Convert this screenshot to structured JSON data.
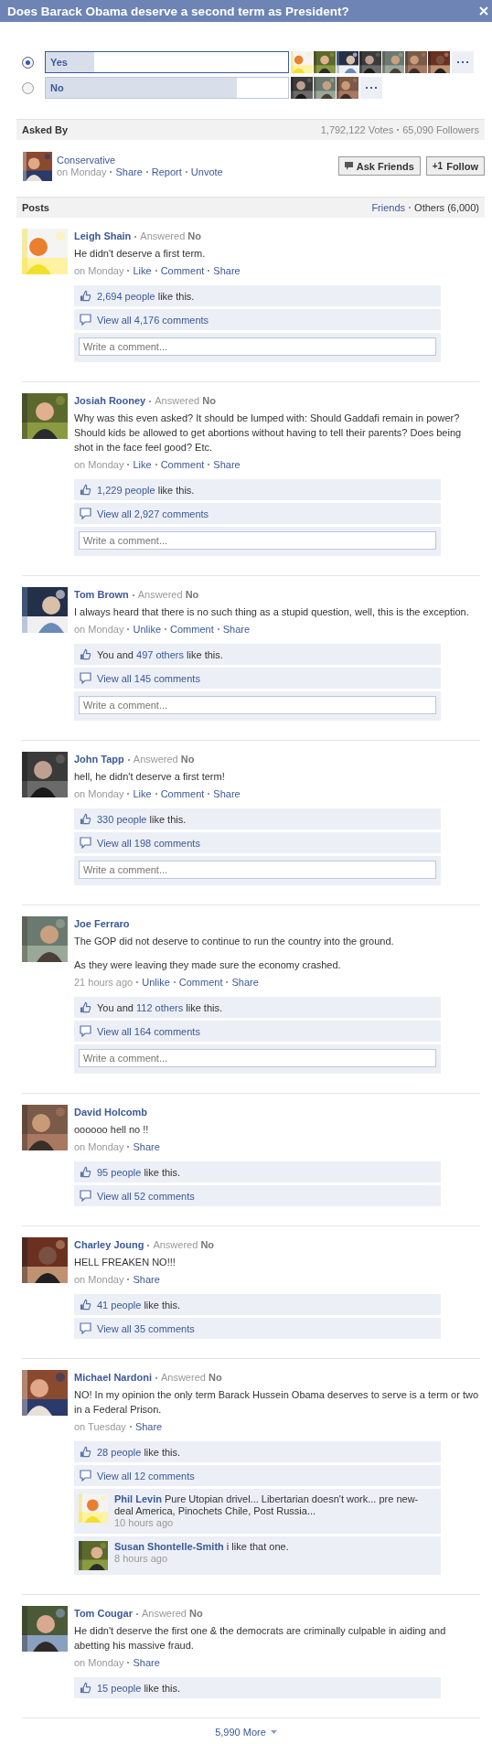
{
  "window": {
    "title": "Does Barack Obama deserve a second term as President?"
  },
  "poll": {
    "options": [
      {
        "label": "Yes",
        "selected": true,
        "level": 0.2,
        "voters": [
          {
            "kind": "picture"
          },
          {
            "kind": "picture"
          },
          {
            "kind": "picture"
          },
          {
            "kind": "picture"
          },
          {
            "kind": "picture"
          },
          {
            "kind": "picture"
          },
          {
            "kind": "picture"
          }
        ]
      },
      {
        "label": "No",
        "selected": false,
        "level": 0.79,
        "voters": [
          {
            "kind": "picture"
          },
          {
            "kind": "picture"
          },
          {
            "kind": "picture"
          }
        ]
      }
    ]
  },
  "asked_by": {
    "heading": "Asked By",
    "stats": [
      "1,792,122 Votes",
      "65,090 Followers"
    ],
    "asker": {
      "name": "Conservative",
      "time": "on Monday",
      "actions": [
        "Share",
        "Report",
        "Unvote"
      ]
    },
    "buttons": [
      {
        "kind": "ask",
        "label": "Ask Friends"
      },
      {
        "kind": "follow",
        "badge": "+1",
        "label": "Follow"
      }
    ]
  },
  "posts_header": {
    "heading": "Posts",
    "filters": [
      {
        "label": "Friends",
        "selected": false
      },
      {
        "label": "Others (6,000)",
        "selected": true
      }
    ]
  },
  "posts": [
    {
      "author": "Leigh Shain",
      "answer": "Answered **No**",
      "paragraphs": [
        "He didn't deserve a first term."
      ],
      "time": "on Monday",
      "actions": [
        "Like",
        "Comment",
        "Share"
      ],
      "likes": {
        "link": "2,694 people",
        "after": " like this."
      },
      "comments_link": "View all 4,176 comments",
      "comment_box": {
        "placeholder": "Write a comment..."
      }
    },
    {
      "author": "Josiah Rooney",
      "answer": "Answered **No**",
      "paragraphs": [
        "Why was this even asked? It should be lumped with: Should Gaddafi remain in power? Should kids be allowed to get abortions without having to tell their parents? Does being shot in the face feel good? Etc."
      ],
      "time": "on Monday",
      "actions": [
        "Like",
        "Comment",
        "Share"
      ],
      "likes": {
        "link": "1,229 people",
        "after": " like this."
      },
      "comments_link": "View all 2,927 comments",
      "comment_box": {
        "placeholder": "Write a comment..."
      }
    },
    {
      "author": "Tom Brown",
      "answer": "Answered **No**",
      "paragraphs": [
        "I always heard that there is no such thing as a stupid question, well, this is the exception."
      ],
      "time": "on Monday",
      "actions": [
        "Unlike",
        "Comment",
        "Share"
      ],
      "likes": {
        "before": "You and ",
        "link": "497 others",
        "after": " like this."
      },
      "comments_link": "View all 145 comments",
      "comment_box": {
        "placeholder": "Write a comment..."
      }
    },
    {
      "author": "John Tapp",
      "answer": "Answered **No**",
      "paragraphs": [
        "hell, he didn't deserve a first term!"
      ],
      "time": "on Monday",
      "actions": [
        "Like",
        "Comment",
        "Share"
      ],
      "likes": {
        "link": "330 people",
        "after": " like this."
      },
      "comments_link": "View all 198 comments",
      "comment_box": {
        "placeholder": "Write a comment..."
      }
    },
    {
      "author": "Joe Ferraro",
      "paragraphs": [
        "The GOP did not deserve to continue to run the country into the ground.",
        "As they were leaving they made sure the economy crashed."
      ],
      "time": "21 hours ago",
      "actions": [
        "Unlike",
        "Comment",
        "Share"
      ],
      "likes": {
        "before": "You and ",
        "link": "112 others",
        "after": " like this."
      },
      "comments_link": "View all 164 comments",
      "comment_box": {
        "placeholder": "Write a comment..."
      }
    },
    {
      "author": "David Holcomb",
      "paragraphs": [
        "oooooo hell no !!"
      ],
      "time": "on Monday",
      "actions": [
        "Share"
      ],
      "likes": {
        "link": "95 people",
        "after": " like this."
      },
      "comments_link": "View all 52 comments"
    },
    {
      "author": "Charley Joung",
      "answer": "Answered **No**",
      "paragraphs": [
        "HELL FREAKEN NO!!!"
      ],
      "time": "on Monday",
      "actions": [
        "Share"
      ],
      "likes": {
        "link": "41 people",
        "after": " like this."
      },
      "comments_link": "View all 35 comments"
    },
    {
      "author": "Michael Nardoni",
      "answer": "Answered **No**",
      "paragraphs": [
        "NO! In my opinion the only term Barack Hussein Obama deserves to serve is a term or two in a Federal Prison."
      ],
      "time": "on Tuesday",
      "actions": [
        "Share"
      ],
      "likes": {
        "link": "28 people",
        "after": " like this."
      },
      "comments_link": "View all 12 comments",
      "replies": [
        {
          "author": "Phil Levin",
          "text": "Pure Utopian drivel... Libertarian doesn't work... pre new-deal America, Pinochets Chile, Post Russia...",
          "time": "10 hours ago"
        },
        {
          "author": "Susan Shontelle-Smith",
          "text": "i like that one.",
          "time": "8 hours ago"
        }
      ]
    },
    {
      "author": "Tom Cougar",
      "answer": "Answered **No**",
      "paragraphs": [
        "He didn't deserve the first one & the democrats are criminally culpable in aiding and abetting his massive fraud."
      ],
      "time": "on Monday",
      "actions": [
        "Share"
      ],
      "likes": {
        "link": "15 people",
        "after": " like this."
      }
    }
  ],
  "more": {
    "label": "5,990 More"
  }
}
